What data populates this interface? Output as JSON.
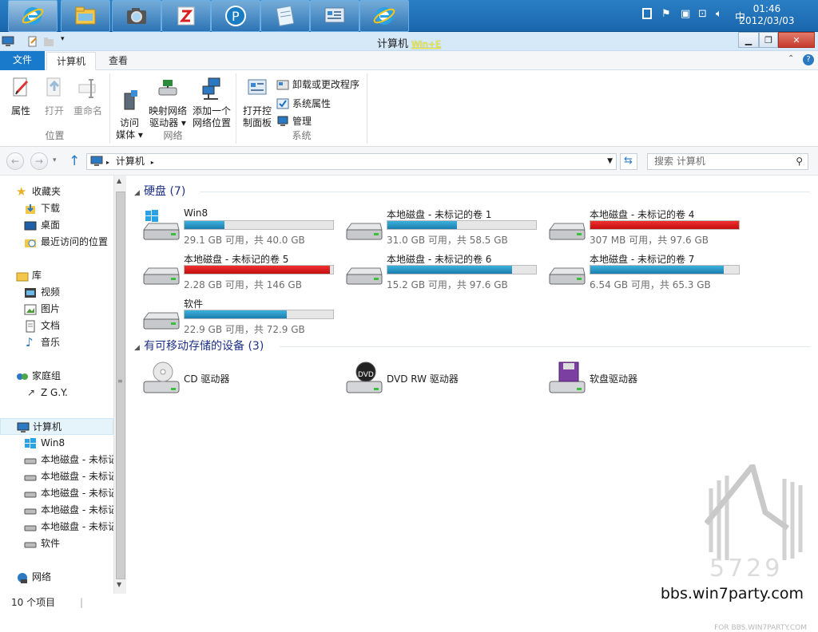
{
  "taskbar": {
    "apps": [
      "ie-icon",
      "file-explorer-icon",
      "camera-icon",
      "paint-icon",
      "p-icon",
      "notepad-icon",
      "control-panel-icon",
      "ie-icon"
    ],
    "tray": {
      "ime": "中"
    },
    "clock": {
      "time": "01:46",
      "date": "2012/03/03"
    }
  },
  "window": {
    "title": "计算机",
    "hotkey": "Win+E"
  },
  "tabs": [
    "文件",
    "计算机",
    "查看"
  ],
  "ribbon": {
    "location": {
      "label": "位置",
      "properties": "属性",
      "open": "打开",
      "rename": "重命名"
    },
    "network": {
      "label": "网络",
      "access_media": "访问\n媒体 ▾",
      "map_drive": "映射网络\n驱动器 ▾",
      "add_location": "添加一个\n网络位置"
    },
    "system": {
      "label": "系统",
      "open_cp": "打开控\n制面板",
      "uninstall": "卸载或更改程序",
      "sys_props": "系统属性",
      "manage": "管理"
    }
  },
  "address": {
    "path": "计算机",
    "search_placeholder": "搜索 计算机"
  },
  "nav": {
    "favorites": "收藏夹",
    "downloads": "下载",
    "desktop": "桌面",
    "recent": "最近访问的位置",
    "libraries": "库",
    "videos": "视频",
    "pictures": "图片",
    "documents": "文档",
    "music": "音乐",
    "homegroup": "家庭组",
    "user": "Z G.Y.",
    "computer": "计算机",
    "drives": [
      "Win8",
      "本地磁盘 - 未标记",
      "本地磁盘 - 未标记",
      "本地磁盘 - 未标记",
      "本地磁盘 - 未标记",
      "本地磁盘 - 未标记",
      "软件"
    ],
    "network": "网络"
  },
  "content": {
    "hdd_group": "硬盘 (7)",
    "removable_group": "有可移动存储的设备 (3)",
    "drives": [
      {
        "name": "Win8",
        "info": "29.1 GB 可用，共 40.0 GB",
        "used": 0.27,
        "low": false
      },
      {
        "name": "本地磁盘 - 未标记的卷 1",
        "info": "31.0 GB 可用，共 58.5 GB",
        "used": 0.47,
        "low": false
      },
      {
        "name": "本地磁盘 - 未标记的卷 4",
        "info": "307 MB 可用，共 97.6 GB",
        "used": 1.0,
        "low": true
      },
      {
        "name": "本地磁盘 - 未标记的卷 5",
        "info": "2.28 GB 可用，共 146 GB",
        "used": 0.98,
        "low": true
      },
      {
        "name": "本地磁盘 - 未标记的卷 6",
        "info": "15.2 GB 可用，共 97.6 GB",
        "used": 0.84,
        "low": false
      },
      {
        "name": "本地磁盘 - 未标记的卷 7",
        "info": "6.54 GB 可用，共 65.3 GB",
        "used": 0.9,
        "low": false
      },
      {
        "name": "软件",
        "info": "22.9 GB 可用，共 72.9 GB",
        "used": 0.69,
        "low": false
      }
    ],
    "removable": [
      "CD 驱动器",
      "DVD RW 驱动器",
      "软盘驱动器"
    ]
  },
  "status": {
    "items": "10 个项目"
  },
  "watermark": {
    "small": "FOR BBS.WIN7PARTY.COM",
    "url": "bbs.win7party.com",
    "logo_text": "5729"
  },
  "colors": {
    "accent": "#1979ca",
    "bar": "#26a0da",
    "bar_low": "#da2626",
    "group_title": "#1e3287"
  }
}
